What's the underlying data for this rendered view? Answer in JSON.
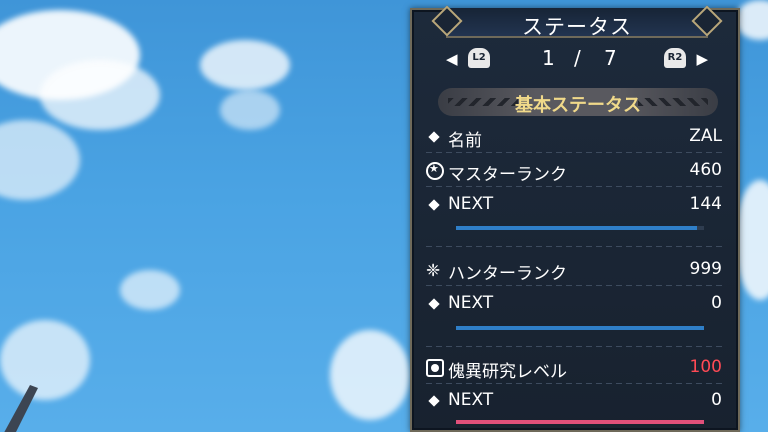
{
  "panel": {
    "title": "ステータス",
    "pager": {
      "left_button": "L2",
      "right_button": "R2",
      "current": "1",
      "separator": "/",
      "total": "7"
    },
    "section_title": "基本ステータス"
  },
  "rows": [
    {
      "label": "名前",
      "value": "ZAL",
      "icon": "diamond-icon"
    },
    {
      "label": "マスターランク",
      "value": "460",
      "icon": "master-rank-icon"
    },
    {
      "label": "NEXT",
      "value": "144",
      "icon": "diamond-icon"
    },
    {
      "label": "ハンターランク",
      "value": "999",
      "icon": "hunter-rank-icon"
    },
    {
      "label": "NEXT",
      "value": "0",
      "icon": "diamond-icon"
    },
    {
      "label": "傀異研究レベル",
      "value": "100",
      "icon": "anomaly-research-icon"
    },
    {
      "label": "NEXT",
      "value": "0",
      "icon": "diamond-icon"
    }
  ],
  "bars": {
    "master_rank_progress": {
      "fraction": 0.97,
      "color": "#2f7fc8"
    },
    "hunter_rank_progress": {
      "fraction": 1.0,
      "color": "#2f7fc8"
    },
    "anomaly_research_progress": {
      "fraction": 1.0,
      "color": "#e0507a"
    }
  },
  "colors": {
    "value_highlight": "#ff4a55",
    "section_text": "#f0d98a"
  }
}
